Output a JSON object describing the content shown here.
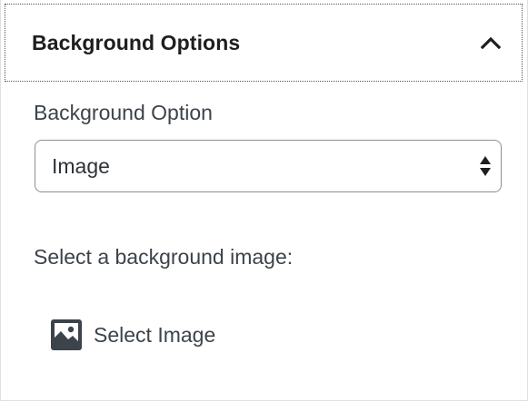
{
  "panel": {
    "title": "Background Options",
    "toggle_icon": "chevron-up-icon"
  },
  "background_option": {
    "label": "Background Option",
    "selected_value": "Image",
    "arrows_icon": "select-arrows-icon"
  },
  "background_image": {
    "label": "Select a background image:",
    "button_label": "Select Image",
    "button_icon": "image-icon"
  },
  "colors": {
    "text_dark": "#1e1e1e",
    "text_muted": "#3c434a",
    "border": "#8c8f94"
  }
}
